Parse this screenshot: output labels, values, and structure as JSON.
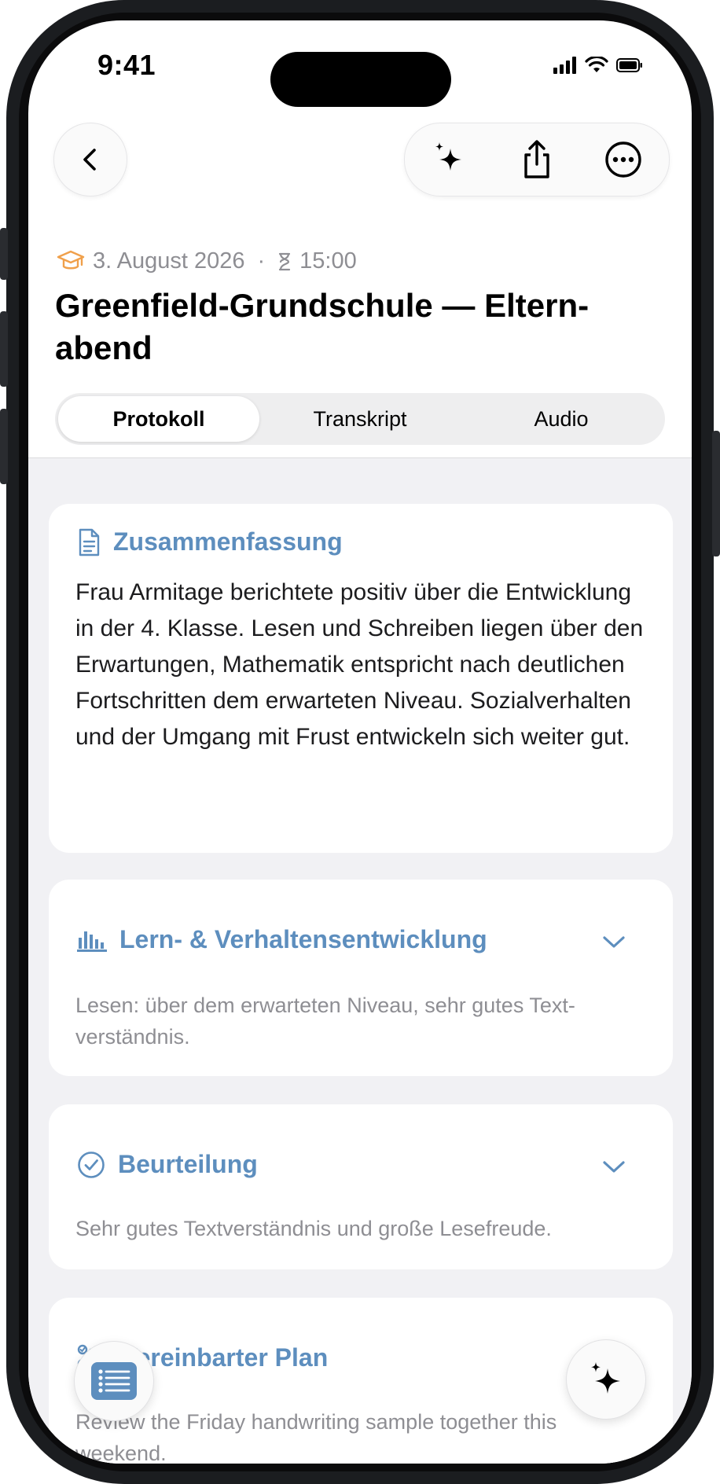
{
  "status_bar": {
    "time": "9:41"
  },
  "meeting": {
    "date": "3. August 2026",
    "separator": "·",
    "time": "15:00",
    "title": "Greenfield-Grundschule — Eltern­abend"
  },
  "tabs": [
    {
      "label": "Protokoll",
      "active": true
    },
    {
      "label": "Transkript",
      "active": false
    },
    {
      "label": "Audio",
      "active": false
    }
  ],
  "cards": {
    "summary": {
      "heading": "Zusammenfassung",
      "body": "Frau Armitage berichtete positiv über die Entwicklung in der 4. Klasse. Lesen und Schreiben liegen über den Erwartungen, Mathematik entspricht nach deutlichen Fort­schritten dem erwarteten Niveau. Sozial­verhalten und der Umgang mit Frust entwickeln sich weiter gut."
    },
    "development": {
      "heading": "Lern- & Verhaltensentwicklung",
      "preview": "Lesen: über dem erwarteten Niveau, sehr gutes Text­verständnis."
    },
    "assessment": {
      "heading": "Beurteilung",
      "preview": "Sehr gutes Textverständnis und große Lesefreude."
    },
    "plan": {
      "heading": "Vereinbarter Plan",
      "preview": "Review the Friday handwriting sample together this weekend."
    }
  },
  "icons": {
    "back": "chevron-left-icon",
    "ai": "sparkles-icon",
    "share": "share-icon",
    "more": "ellipsis-circle-icon",
    "school": "graduation-cap-icon",
    "duration": "hourglass-icon",
    "summary": "document-icon",
    "development": "bar-chart-icon",
    "assessment": "checkmark-circle-icon",
    "plan": "checklist-icon",
    "toc": "list-icon"
  },
  "colors": {
    "accent": "#5d8ebe",
    "school_icon": "#f0a04b",
    "toc_button": "#5d8ebe"
  }
}
